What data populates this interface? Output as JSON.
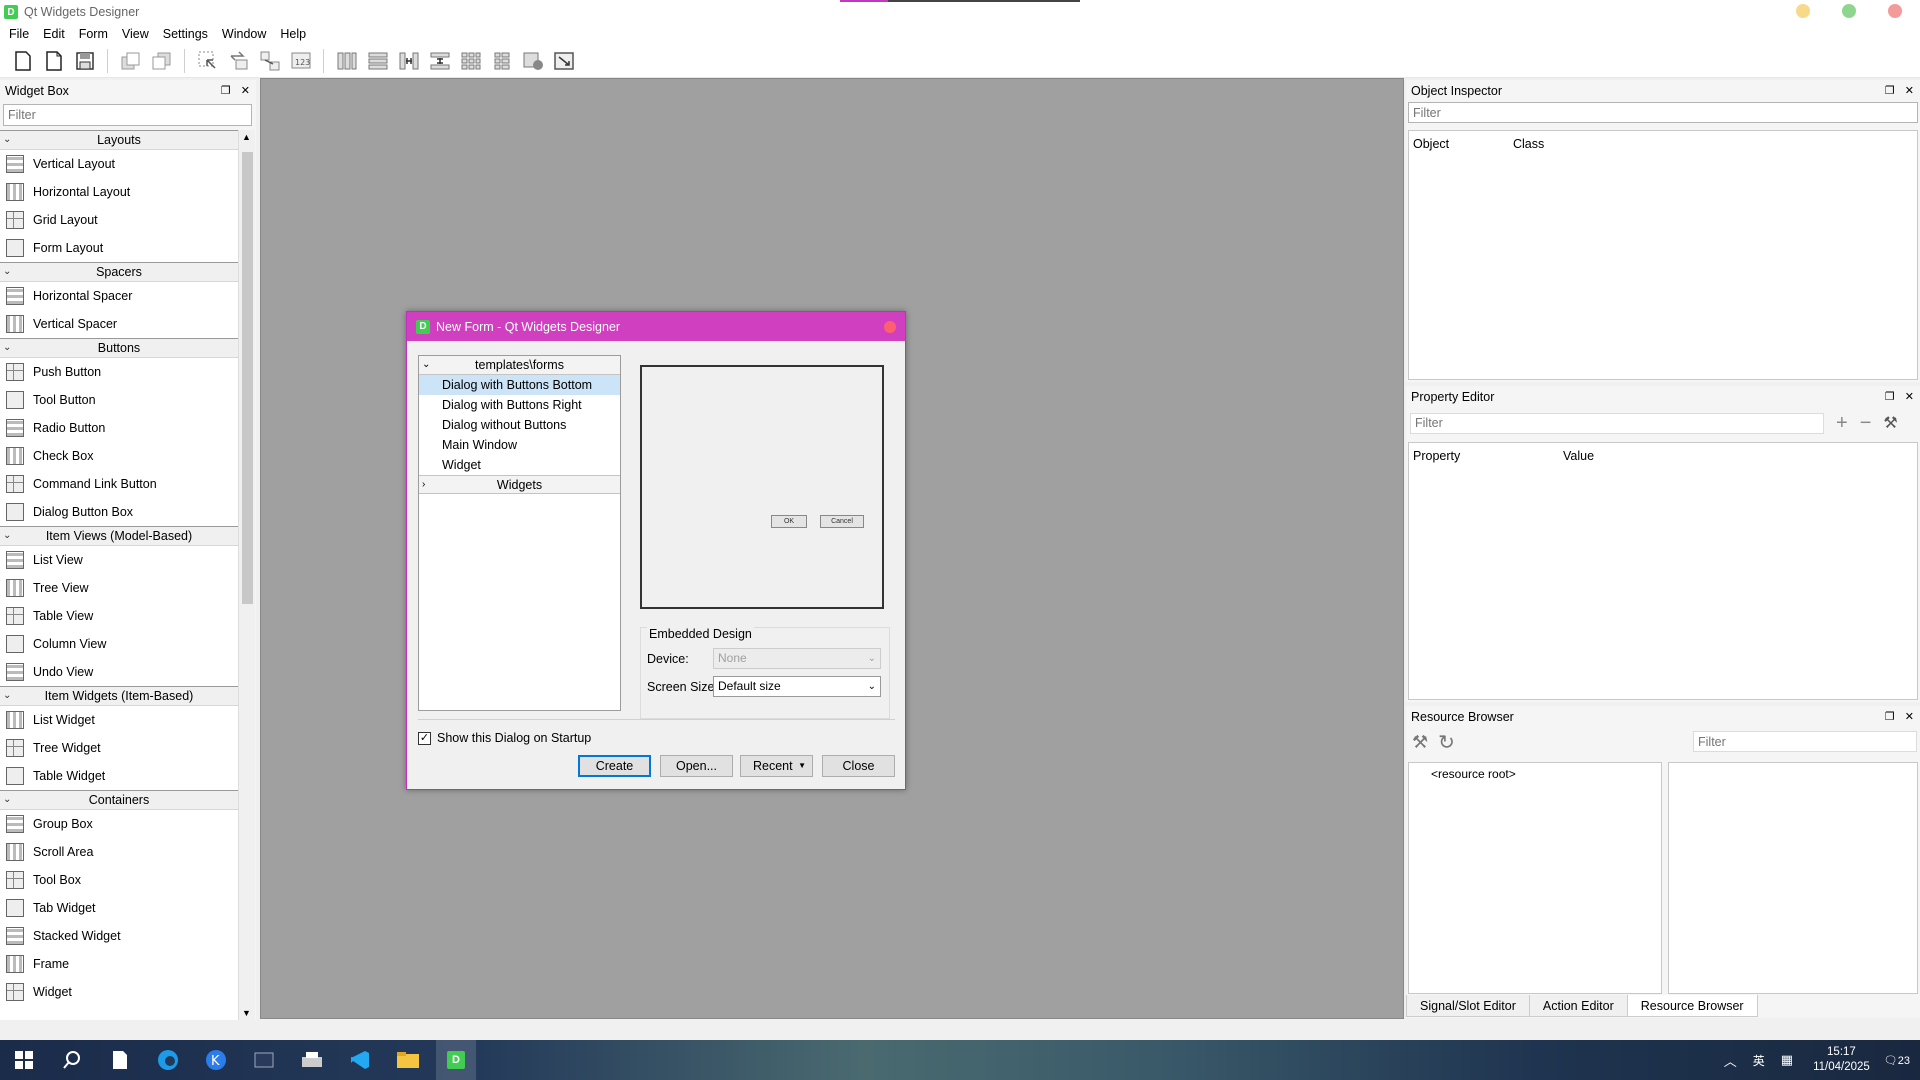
{
  "app": {
    "title": "Qt Widgets Designer",
    "icon_letter": "D"
  },
  "colors": {
    "accent": "#0078d7",
    "dialog_title": "#cf3fbf",
    "qt_green": "#41cd52",
    "mdi_background": "#a0a0a0"
  },
  "menu": [
    "File",
    "Edit",
    "Form",
    "View",
    "Settings",
    "Window",
    "Help"
  ],
  "toolbar_icons": [
    "new-form-icon",
    "open-form-icon",
    "save-form-icon",
    "bring-to-front-icon",
    "send-to-back-icon",
    "edit-widgets-icon",
    "edit-signals-icon",
    "edit-buddies-icon",
    "edit-tab-order-icon",
    "layout-horizontal-icon",
    "layout-vertical-icon",
    "layout-h-splitter-icon",
    "layout-v-splitter-icon",
    "layout-grid-icon",
    "layout-form-icon",
    "break-layout-icon",
    "adjust-size-icon"
  ],
  "widget_box": {
    "title": "Widget Box",
    "filter_placeholder": "Filter",
    "categories": [
      {
        "name": "Layouts",
        "items": [
          "Vertical Layout",
          "Horizontal Layout",
          "Grid Layout",
          "Form Layout"
        ]
      },
      {
        "name": "Spacers",
        "items": [
          "Horizontal Spacer",
          "Vertical Spacer"
        ]
      },
      {
        "name": "Buttons",
        "items": [
          "Push Button",
          "Tool Button",
          "Radio Button",
          "Check Box",
          "Command Link Button",
          "Dialog Button Box"
        ]
      },
      {
        "name": "Item Views (Model-Based)",
        "items": [
          "List View",
          "Tree View",
          "Table View",
          "Column View",
          "Undo View"
        ]
      },
      {
        "name": "Item Widgets (Item-Based)",
        "items": [
          "List Widget",
          "Tree Widget",
          "Table Widget"
        ]
      },
      {
        "name": "Containers",
        "items": [
          "Group Box",
          "Scroll Area",
          "Tool Box",
          "Tab Widget",
          "Stacked Widget",
          "Frame",
          "Widget"
        ]
      }
    ]
  },
  "object_inspector": {
    "title": "Object Inspector",
    "filter_placeholder": "Filter",
    "col_object": "Object",
    "col_class": "Class"
  },
  "property_editor": {
    "title": "Property Editor",
    "filter_placeholder": "Filter",
    "col_property": "Property",
    "col_value": "Value"
  },
  "resource_browser": {
    "title": "Resource Browser",
    "filter_placeholder": "Filter",
    "root": "<resource root>"
  },
  "bottom_tabs": [
    "Signal/Slot Editor",
    "Action Editor",
    "Resource Browser"
  ],
  "dialog": {
    "title": "New Form - Qt Widgets Designer",
    "tree_header": "templates\\forms",
    "templates": [
      "Dialog with Buttons Bottom",
      "Dialog with Buttons Right",
      "Dialog without Buttons",
      "Main Window",
      "Widget"
    ],
    "selected_template": "Dialog with Buttons Bottom",
    "widgets_label": "Widgets",
    "preview_ok": "OK",
    "preview_cancel": "Cancel",
    "embedded_title": "Embedded Design",
    "device_label": "Device:",
    "device_value": "None",
    "screen_label": "Screen Size:",
    "screen_value": "Default size",
    "show_on_startup": "Show this Dialog on Startup",
    "show_on_startup_checked": true,
    "buttons": {
      "create": "Create",
      "open": "Open...",
      "recent": "Recent",
      "close": "Close"
    }
  },
  "taskbar": {
    "time": "15:17",
    "date": "11/04/2025",
    "notifications": "23",
    "ime": "英"
  }
}
